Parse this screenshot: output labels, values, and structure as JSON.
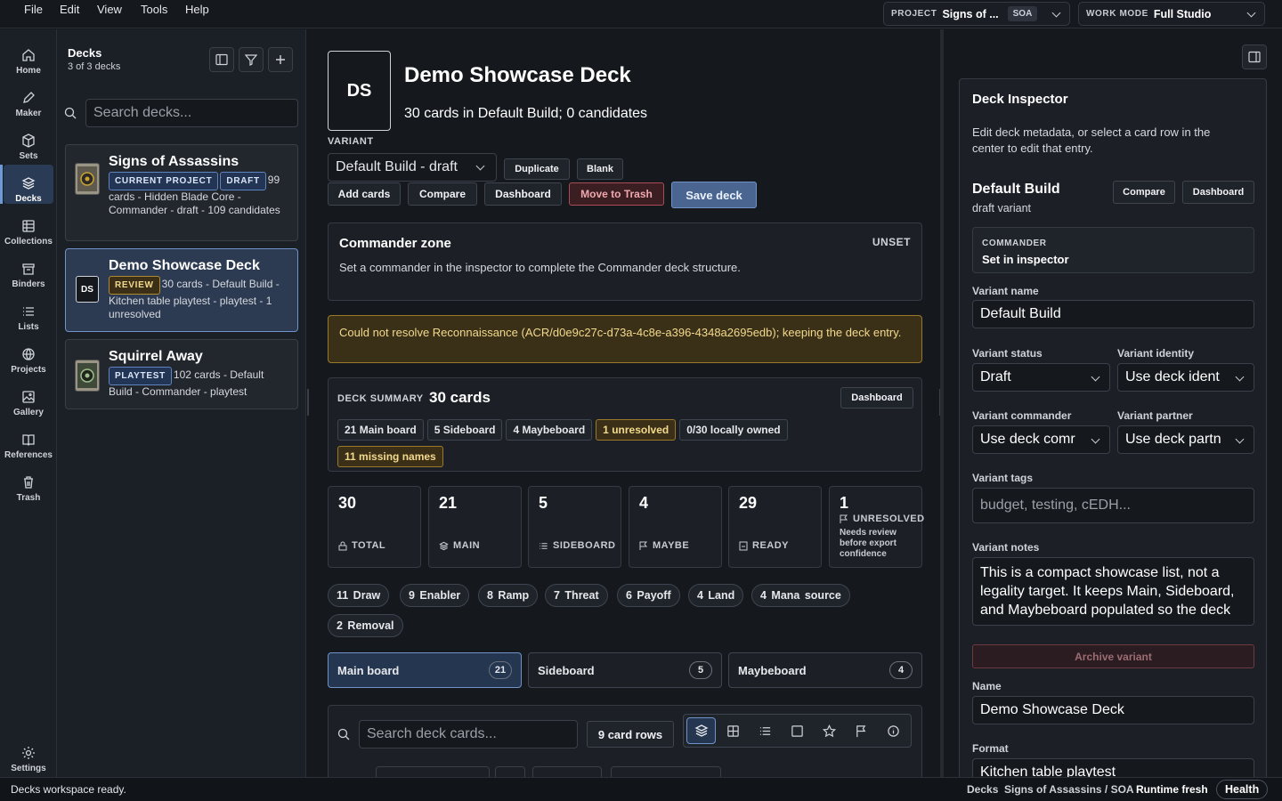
{
  "menu": {
    "items": [
      "File",
      "Edit",
      "View",
      "Tools",
      "Help"
    ]
  },
  "project_select": {
    "label": "PROJECT",
    "value": "Signs of ...",
    "badge": "SOA"
  },
  "workmode_select": {
    "label": "WORK MODE",
    "value": "Full Studio"
  },
  "rail": {
    "items": [
      {
        "label": "Home",
        "icon": "home-icon"
      },
      {
        "label": "Maker",
        "icon": "pen-icon"
      },
      {
        "label": "Sets",
        "icon": "cube-icon"
      },
      {
        "label": "Decks",
        "icon": "layers-icon"
      },
      {
        "label": "Collections",
        "icon": "grid-icon"
      },
      {
        "label": "Binders",
        "icon": "box-icon"
      },
      {
        "label": "Lists",
        "icon": "list-icon"
      },
      {
        "label": "Projects",
        "icon": "globe-icon"
      },
      {
        "label": "Gallery",
        "icon": "image-icon"
      },
      {
        "label": "References",
        "icon": "book-icon"
      },
      {
        "label": "Trash",
        "icon": "trash-icon"
      }
    ],
    "settings_label": "Settings"
  },
  "decks_panel": {
    "title": "Decks",
    "subtitle": "3 of 3 decks",
    "search_placeholder": "Search decks...",
    "decks": [
      {
        "name": "Signs of Assassins",
        "badges": [
          "CURRENT PROJECT",
          "DRAFT"
        ],
        "desc": "99 cards - Hidden Blade Core - Commander - draft - 109 candidates"
      },
      {
        "name": "Demo Showcase Deck",
        "initials": "DS",
        "badges": [
          "REVIEW"
        ],
        "desc": "30 cards - Default Build - Kitchen table playtest - playtest - 1 unresolved"
      },
      {
        "name": "Squirrel Away",
        "badges": [
          "PLAYTEST"
        ],
        "desc": "102 cards - Default Build - Commander - playtest"
      }
    ]
  },
  "deck": {
    "initials": "DS",
    "title": "Demo Showcase Deck",
    "subtitle": "30 cards in Default Build; 0 candidates",
    "variant_label": "VARIANT",
    "variant_value": "Default Build - draft",
    "duplicate_label": "Duplicate",
    "blank_label": "Blank",
    "add_cards_label": "Add cards",
    "compare_label": "Compare",
    "dashboard_label": "Dashboard",
    "trash_label": "Move to Trash",
    "save_label": "Save deck"
  },
  "commander_zone": {
    "title": "Commander zone",
    "status": "UNSET",
    "text": "Set a commander in the inspector to complete the Commander deck structure."
  },
  "warning": {
    "text": "Could not resolve Reconnaissance (ACR/d0e9c27c-d73a-4c8e-a396-4348a2695edb); keeping the deck entry."
  },
  "summary": {
    "label": "DECK SUMMARY",
    "count": "30 cards",
    "dashboard_label": "Dashboard",
    "chips": [
      {
        "n": "21",
        "t": "Main board",
        "gold": false
      },
      {
        "n": "5",
        "t": "Sideboard",
        "gold": false
      },
      {
        "n": "4",
        "t": "Maybeboard",
        "gold": false
      },
      {
        "n": "1",
        "t": "unresolved",
        "gold": true
      },
      {
        "n": "0/30",
        "t": "locally owned",
        "gold": false
      },
      {
        "n": "11",
        "t": "missing names",
        "gold": true
      }
    ]
  },
  "stats": [
    {
      "num": "30",
      "label": "TOTAL"
    },
    {
      "num": "21",
      "label": "MAIN"
    },
    {
      "num": "5",
      "label": "SIDEBOARD"
    },
    {
      "num": "4",
      "label": "MAYBE"
    },
    {
      "num": "29",
      "label": "READY"
    },
    {
      "num": "1",
      "label": "UNRESOLVED",
      "note": "Needs review before export confidence"
    }
  ],
  "roles": [
    "11 Draw",
    "9 Enabler",
    "8 Ramp",
    "7 Threat",
    "6 Payoff",
    "4 Land",
    "4 Mana source",
    "2 Removal"
  ],
  "board_tabs": [
    {
      "label": "Main board",
      "count": "21"
    },
    {
      "label": "Sideboard",
      "count": "5"
    },
    {
      "label": "Maybeboard",
      "count": "4"
    }
  ],
  "card_search": {
    "placeholder": "Search deck cards...",
    "rows_label": "9 card rows"
  },
  "inspector": {
    "title": "Deck Inspector",
    "desc": "Edit deck metadata, or select a card row in the center to edit that entry.",
    "variant_title": "Default Build",
    "variant_sub": "draft variant",
    "compare_label": "Compare",
    "dashboard_label": "Dashboard",
    "commander_label": "COMMANDER",
    "commander_value": "Set in inspector",
    "variant_name_label": "Variant name",
    "variant_name": "Default Build",
    "variant_status_label": "Variant status",
    "variant_status": "Draft",
    "variant_identity_label": "Variant identity",
    "variant_identity": "Use deck ident",
    "variant_commander_label": "Variant commander",
    "variant_commander": "Use deck comr",
    "variant_partner_label": "Variant partner",
    "variant_partner": "Use deck partn",
    "variant_tags_label": "Variant tags",
    "variant_tags_placeholder": "budget, testing, cEDH...",
    "variant_notes_label": "Variant notes",
    "variant_notes": "This is a compact showcase list, not a legality target. It keeps Main, Sideboard, and Maybeboard populated so the deck",
    "archive_label": "Archive variant",
    "name_label": "Name",
    "name_value": "Demo Showcase Deck",
    "format_label": "Format",
    "format_value": "Kitchen table playtest"
  },
  "statusbar": {
    "left": "Decks workspace ready.",
    "section": "Decks",
    "path": "Signs of Assassins / SOA",
    "runtime": "Runtime fresh",
    "health": "Health"
  },
  "colors": {
    "accent": "#6f93c8",
    "gold": "#f3d98d",
    "danger": "#e58a8a"
  }
}
